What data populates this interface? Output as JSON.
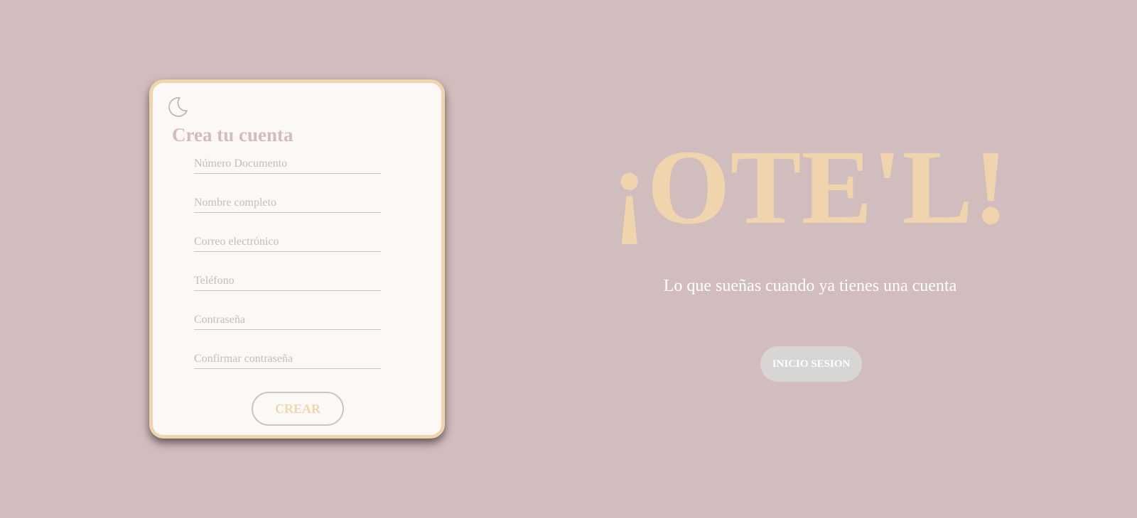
{
  "register": {
    "theme_toggle_icon": "moon-icon",
    "title": "Crea tu cuenta",
    "fields": [
      {
        "placeholder": "Número Documento",
        "value": ""
      },
      {
        "placeholder": "Nombre completo",
        "value": ""
      },
      {
        "placeholder": "Correo electrónico",
        "value": ""
      },
      {
        "placeholder": "Teléfono",
        "value": ""
      },
      {
        "placeholder": "Contraseña",
        "value": ""
      },
      {
        "placeholder": "Confirmar contraseña",
        "value": ""
      }
    ],
    "create_label": "CREAR"
  },
  "hero": {
    "brand": "¡OTE'L!",
    "tagline": "Lo que sueñas cuando ya tienes una cuenta",
    "login_label": "INICIO SESION"
  },
  "colors": {
    "background": "#d2bdbe",
    "card": "#fcf8f5",
    "accent": "#efd4ad",
    "title": "#d4bcbd",
    "login_button": "#d8d5d5"
  }
}
